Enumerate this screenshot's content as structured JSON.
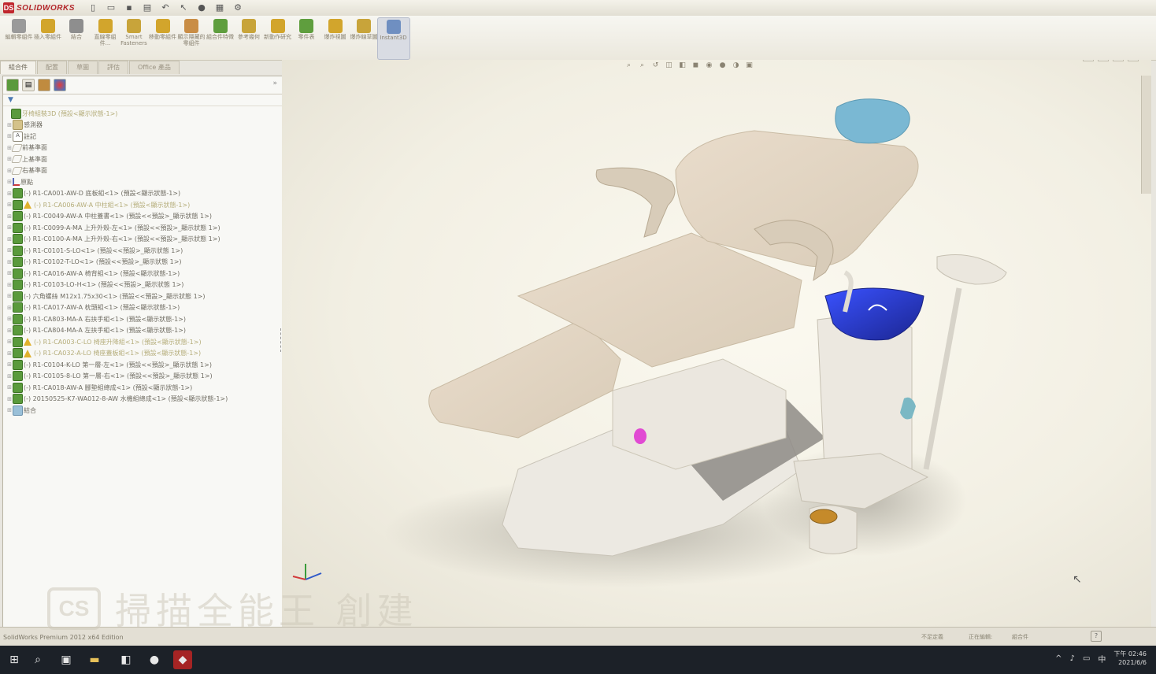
{
  "app": {
    "logo_text": "SOLIDWORKS",
    "edition": "SolidWorks Premium 2012 x64 Edition"
  },
  "ribbon": {
    "buttons": [
      {
        "label": "編輯零組件",
        "icon": "edit-component-icon",
        "color": "#9a9a9a"
      },
      {
        "label": "插入零組件",
        "icon": "insert-components-icon",
        "color": "#d2a52c"
      },
      {
        "label": "結合",
        "icon": "mate-icon",
        "color": "#8e8e8e"
      },
      {
        "label": "直線零組件...",
        "icon": "linear-pattern-icon",
        "color": "#d2a52c"
      },
      {
        "label": "Smart Fasteners",
        "icon": "smart-fasteners-icon",
        "color": "#c8a43a"
      },
      {
        "label": "移動零組件",
        "icon": "move-component-icon",
        "color": "#d2a52c"
      },
      {
        "label": "顯示隱藏的零組件",
        "icon": "show-hidden-icon",
        "color": "#c98d45"
      },
      {
        "label": "組合件特徵",
        "icon": "assembly-features-icon",
        "color": "#5f9e3e"
      },
      {
        "label": "參考幾何",
        "icon": "reference-geometry-icon",
        "color": "#c8a43a"
      },
      {
        "label": "新動作研究",
        "icon": "motion-study-icon",
        "color": "#d2a52c"
      },
      {
        "label": "零件表",
        "icon": "bom-icon",
        "color": "#5f9e3e"
      },
      {
        "label": "爆炸視圖",
        "icon": "exploded-view-icon",
        "color": "#d2a52c"
      },
      {
        "label": "爆炸線草圖",
        "icon": "explode-line-icon",
        "color": "#c8a43a"
      },
      {
        "label": "Instant3D",
        "icon": "instant3d-icon",
        "color": "#6f8fc1"
      }
    ]
  },
  "command_tabs": [
    "組合件",
    "配置",
    "草圖",
    "評估",
    "Office 產品"
  ],
  "feature_manager": {
    "filter_icon": "filter-icon",
    "tree": [
      {
        "label": "牙椅組裝3D (預設<顯示狀態-1>)",
        "icon": "assembly",
        "dim": true,
        "indent": 0
      },
      {
        "label": "感測器",
        "icon": "folder",
        "dim": false,
        "indent": 1
      },
      {
        "label": "註記",
        "icon": "ann",
        "dim": false,
        "indent": 1
      },
      {
        "label": "前基準面",
        "icon": "plane",
        "dim": false,
        "indent": 1
      },
      {
        "label": "上基準面",
        "icon": "plane",
        "dim": false,
        "indent": 1
      },
      {
        "label": "右基準面",
        "icon": "plane",
        "dim": false,
        "indent": 1
      },
      {
        "label": "原點",
        "icon": "origin",
        "dim": false,
        "indent": 1
      },
      {
        "label": "(-) R1-CA001-AW-D 底板組<1> (預設<顯示狀態-1>)",
        "icon": "part",
        "dim": false,
        "indent": 1
      },
      {
        "label": "(-) R1-CA006-AW-A 中柱組<1> (預設<顯示狀態-1>)",
        "icon": "warn",
        "dim": true,
        "indent": 1
      },
      {
        "label": "(-) R1-C0049-AW-A 中柱蓋書<1> (預設<<預設>_顯示狀態 1>)",
        "icon": "part",
        "dim": false,
        "indent": 1
      },
      {
        "label": "(-) R1-C0099-A-MA 上升外殼-左<1> (預設<<預設>_顯示狀態 1>)",
        "icon": "part",
        "dim": false,
        "indent": 1
      },
      {
        "label": "(-) R1-C0100-A-MA 上升外殼-右<1> (預設<<預設>_顯示狀態 1>)",
        "icon": "part",
        "dim": false,
        "indent": 1
      },
      {
        "label": "(-) R1-C0101-S-LO<1> (預設<<預設>_顯示狀態 1>)",
        "icon": "part",
        "dim": false,
        "indent": 1
      },
      {
        "label": "(-) R1-C0102-T-LO<1> (預設<<預設>_顯示狀態 1>)",
        "icon": "part",
        "dim": false,
        "indent": 1
      },
      {
        "label": "(-) R1-CA016-AW-A 椅背組<1> (預設<顯示狀態-1>)",
        "icon": "part",
        "dim": false,
        "indent": 1
      },
      {
        "label": "(-) R1-C0103-LO-H<1> (預設<<預設>_顯示狀態 1>)",
        "icon": "part",
        "dim": false,
        "indent": 1
      },
      {
        "label": "(-) 六角螺絲 M12x1.75x30<1> (預設<<預設>_顯示狀態 1>)",
        "icon": "part",
        "dim": false,
        "indent": 1
      },
      {
        "label": "(-) R1-CA017-AW-A 枕頭組<1> (預設<顯示狀態-1>)",
        "icon": "part",
        "dim": false,
        "indent": 1
      },
      {
        "label": "(-) R1-CA803-MA-A 右扶手組<1> (預設<顯示狀態-1>)",
        "icon": "part",
        "dim": false,
        "indent": 1
      },
      {
        "label": "(-) R1-CA804-MA-A 左扶手組<1> (預設<顯示狀態-1>)",
        "icon": "part",
        "dim": false,
        "indent": 1
      },
      {
        "label": "(-) R1-CA003-C-LO 椅座升降組<1> (預設<顯示狀態-1>)",
        "icon": "warn",
        "dim": true,
        "indent": 1
      },
      {
        "label": "(-) R1-CA032-A-LO 椅座蓋板組<1> (預設<顯示狀態-1>)",
        "icon": "warn",
        "dim": true,
        "indent": 1
      },
      {
        "label": "(-) R1-C0104-K-LO 第一層-左<1> (預設<<預設>_顯示狀態 1>)",
        "icon": "part",
        "dim": false,
        "indent": 1
      },
      {
        "label": "(-) R1-C0105-8-LO 第一層-右<1> (預設<<預設>_顯示狀態 1>)",
        "icon": "part",
        "dim": false,
        "indent": 1
      },
      {
        "label": "(-) R1-CA018-AW-A 腳墊組總成<1> (預設<顯示狀態-1>)",
        "icon": "part",
        "dim": false,
        "indent": 1
      },
      {
        "label": "(-) 20150525-K7-WA012-8-AW 水機組總成<1> (預設<顯示狀態-1>)",
        "icon": "part",
        "dim": false,
        "indent": 1
      },
      {
        "label": "結合",
        "icon": "mate",
        "dim": false,
        "indent": 1
      }
    ]
  },
  "viewport": {
    "heads_up_icons": [
      "zoom-to-fit-icon",
      "zoom-area-icon",
      "previous-view-icon",
      "section-view-icon",
      "view-orientation-icon",
      "display-style-icon",
      "hide-show-icon",
      "edit-appearance-icon",
      "apply-scene-icon",
      "view-settings-icon"
    ]
  },
  "status": {
    "items": [
      "不足定義",
      "正在編輯:",
      "組合件"
    ]
  },
  "taskbar": {
    "clock_time": "下午 02:46",
    "clock_date": "2021/6/6"
  },
  "watermark": {
    "box_text": "CS",
    "text": "掃描全能王 創建"
  },
  "colors": {
    "chair_body": "#e2d5c2",
    "headrest": "#7ab8d3",
    "spittoon_bowl": "#2a3bd6",
    "cup": "#c58a2a"
  }
}
